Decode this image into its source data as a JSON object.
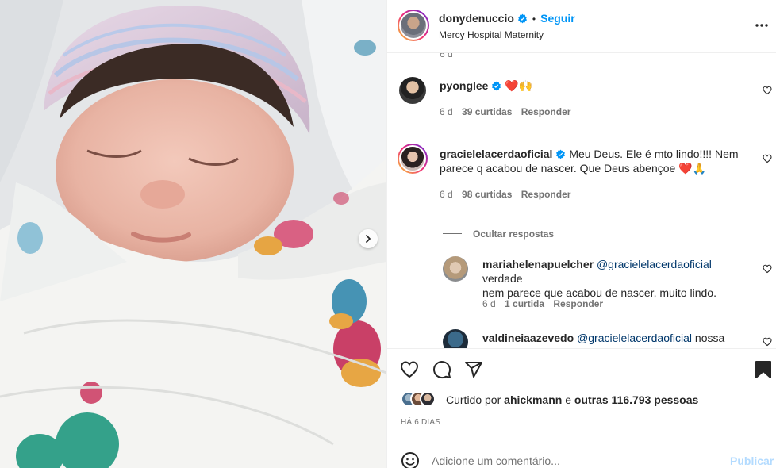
{
  "header": {
    "username": "donydenuccio",
    "follow_label": "Seguir",
    "dot": "•",
    "location": "Mercy Hospital Maternity"
  },
  "comments": {
    "top_partial_time": "6 d",
    "items": [
      {
        "username": "pyonglee",
        "text": "",
        "emoji": "❤️🙌",
        "time": "6 d",
        "likes": "39 curtidas",
        "reply": "Responder"
      },
      {
        "username": "gracielelacerdaoficial",
        "text_line1": "Meu Deus. Ele é mto lindo!!!! Nem",
        "text_line2": "parece q acabou de nascer. Que Deus abençoe",
        "emoji": "❤️🙏",
        "time": "6 d",
        "likes": "98 curtidas",
        "reply": "Responder"
      }
    ],
    "hide_replies": "Ocultar respostas",
    "replies": [
      {
        "username": "mariahelenapuelcher",
        "mention": "@gracielelacerdaoficial",
        "text_line1": "verdade",
        "text_line2": "nem parece que acabou de nascer, muito lindo.",
        "time": "6 d",
        "likes": "1 curtida",
        "reply": "Responder"
      },
      {
        "username": "valdineiaazevedo",
        "mention": "@gracielelacerdaoficial",
        "text_line1": "nossa"
      }
    ]
  },
  "actions": {
    "liked_prefix": "Curtido por",
    "liked_user": "ahickmann",
    "liked_and": "e",
    "liked_others": "outras 116.793 pessoas",
    "date": "HÁ 6 DIAS"
  },
  "add_comment": {
    "placeholder": "Adicione um comentário...",
    "publish": "Publicar"
  },
  "colors": {
    "link_blue": "#0095f6",
    "heart_red": "#ed4956",
    "muted": "#737373"
  },
  "icons": [
    "verified-badge-icon",
    "more-options-icon",
    "heart-icon",
    "comment-icon",
    "share-icon",
    "bookmark-icon",
    "emoji-icon",
    "chevron-right-icon"
  ]
}
